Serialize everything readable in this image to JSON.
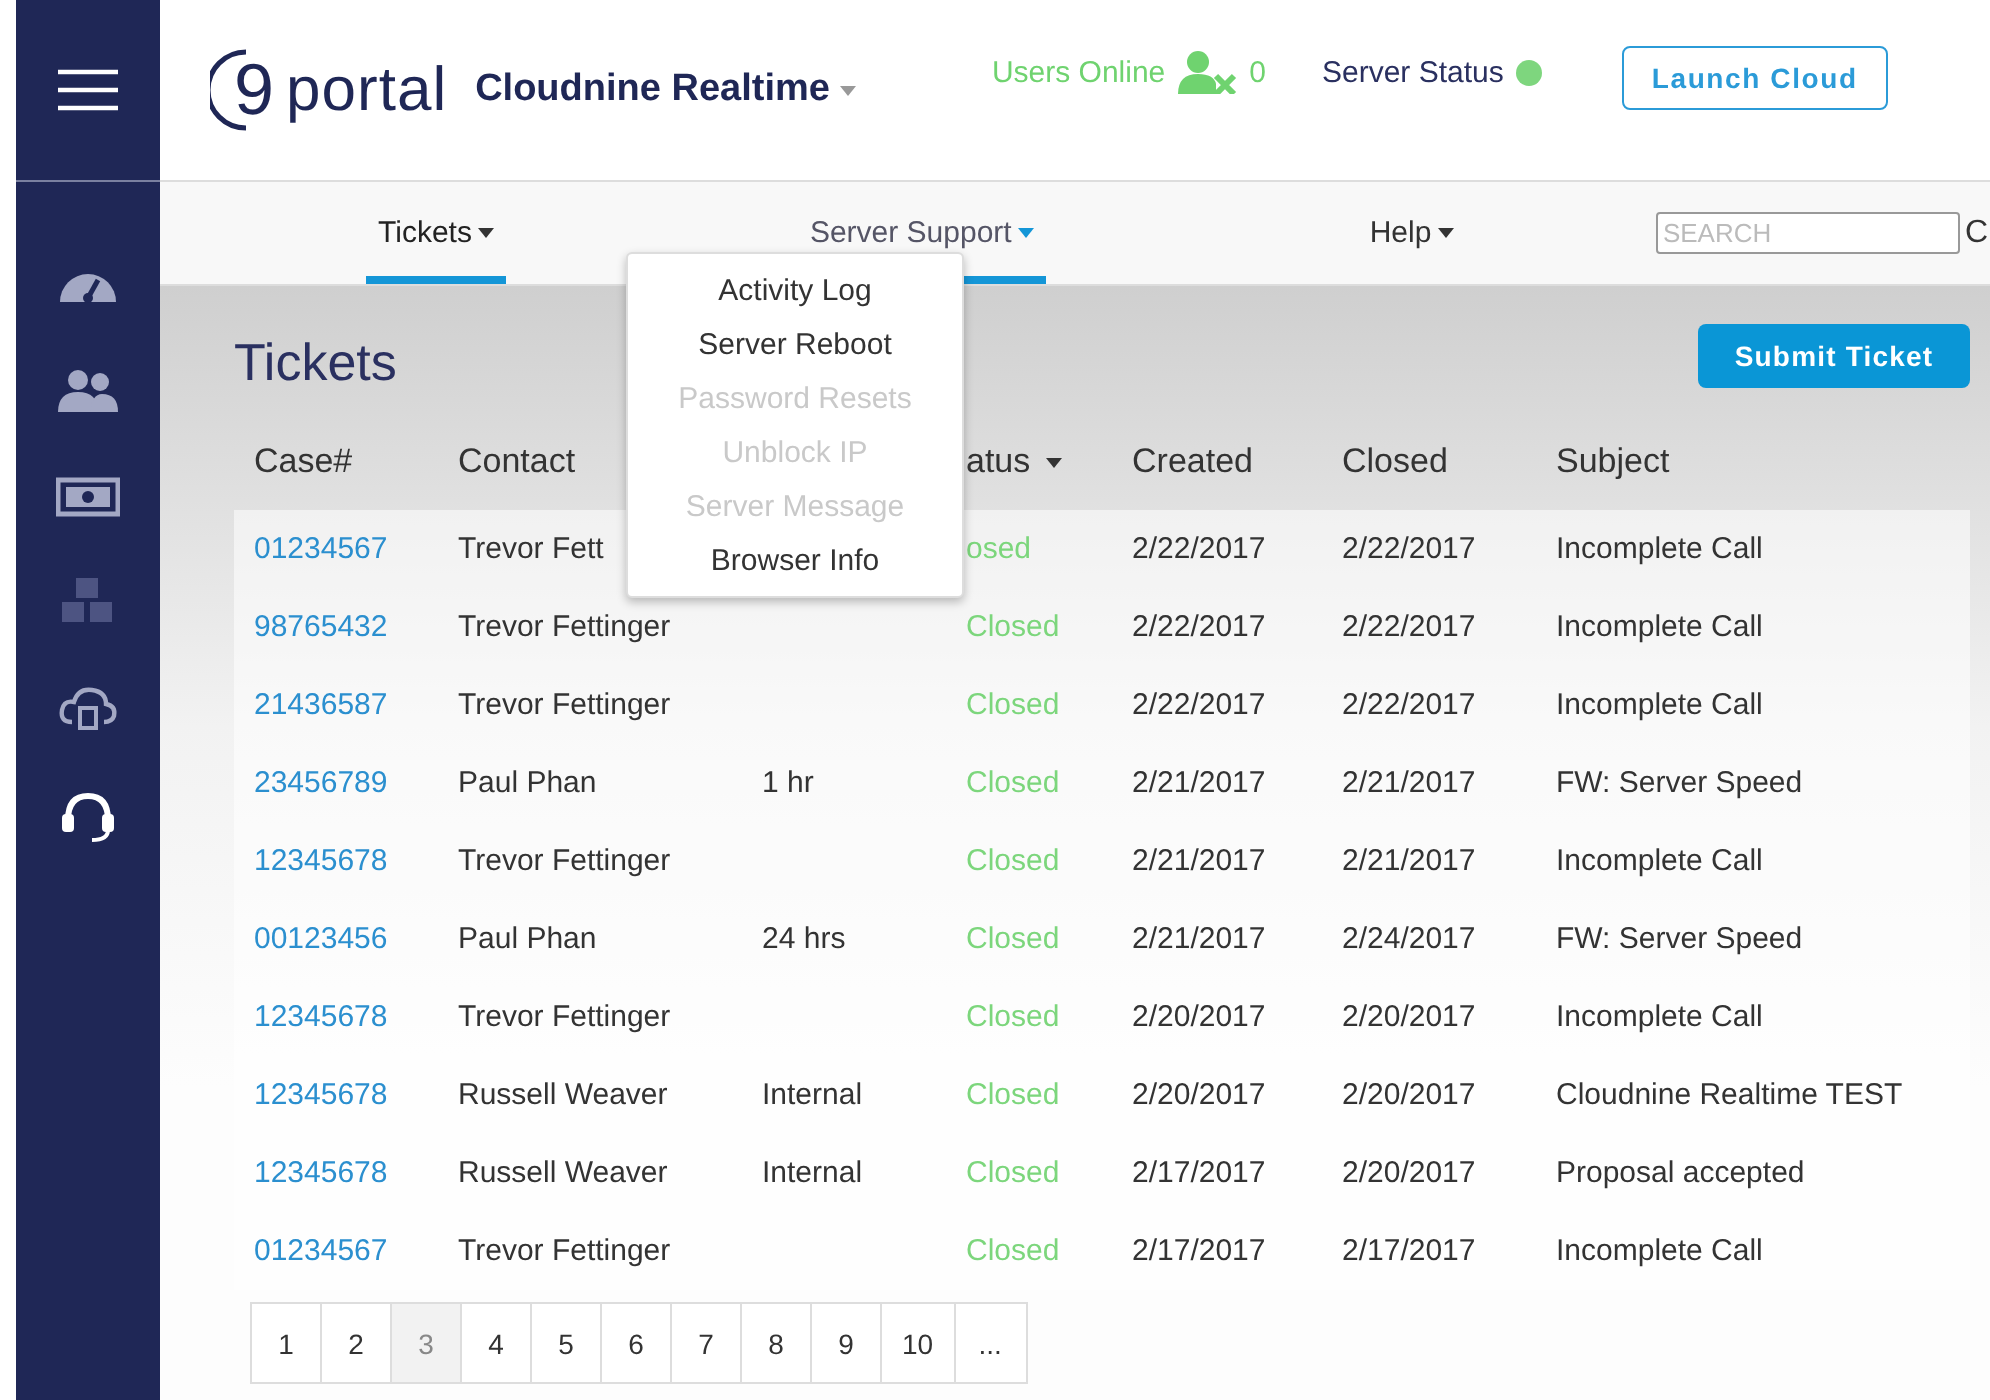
{
  "sidebar": {
    "items": [
      {
        "selected": false,
        "disabled": false
      },
      {
        "selected": false,
        "disabled": false
      },
      {
        "selected": false,
        "disabled": false
      },
      {
        "selected": false,
        "disabled": true
      },
      {
        "selected": false,
        "disabled": false
      },
      {
        "selected": true,
        "disabled": false
      }
    ]
  },
  "header": {
    "logo": {
      "mark": "9",
      "text": "portal"
    },
    "account": "Cloudnine Realtime",
    "users_online": {
      "label": "Users Online",
      "count": "0"
    },
    "server_status": {
      "label": "Server Status",
      "color": "#7ed67e"
    },
    "launch_button": "Launch Cloud"
  },
  "nav": {
    "items": [
      {
        "label": "Tickets",
        "selected": true,
        "expanded": false
      },
      {
        "label": "Server Support",
        "selected": false,
        "expanded": true
      },
      {
        "label": "Help",
        "selected": false,
        "expanded": false
      }
    ],
    "search": {
      "placeholder": "SEARCH"
    },
    "edge_text": "C"
  },
  "dropdown": {
    "items": [
      {
        "label": "Activity Log",
        "disabled": false
      },
      {
        "label": "Server Reboot",
        "disabled": false
      },
      {
        "label": "Password Resets",
        "disabled": true
      },
      {
        "label": "Unblock IP",
        "disabled": true
      },
      {
        "label": "Server Message",
        "disabled": true
      },
      {
        "label": "Browser Info",
        "disabled": false
      }
    ]
  },
  "page": {
    "title": "Tickets",
    "submit_button": "Submit Ticket"
  },
  "table": {
    "columns": [
      "Case#",
      "Contact",
      "",
      "atus",
      "Created",
      "Closed",
      "Subject"
    ],
    "rows": [
      [
        "01234567",
        "Trevor Fett",
        "",
        "osed",
        "2/22/2017",
        "2/22/2017",
        "Incomplete Call"
      ],
      [
        "98765432",
        "Trevor Fettinger",
        "",
        "Closed",
        "2/22/2017",
        "2/22/2017",
        "Incomplete Call"
      ],
      [
        "21436587",
        "Trevor Fettinger",
        "",
        "Closed",
        "2/22/2017",
        "2/22/2017",
        "Incomplete Call"
      ],
      [
        "23456789",
        "Paul Phan",
        "1 hr",
        "Closed",
        "2/21/2017",
        "2/21/2017",
        "FW: Server Speed"
      ],
      [
        "12345678",
        "Trevor Fettinger",
        "",
        "Closed",
        "2/21/2017",
        "2/21/2017",
        "Incomplete Call"
      ],
      [
        "00123456",
        "Paul Phan",
        "24 hrs",
        "Closed",
        "2/21/2017",
        "2/24/2017",
        "FW: Server Speed"
      ],
      [
        "12345678",
        "Trevor Fettinger",
        "",
        "Closed",
        "2/20/2017",
        "2/20/2017",
        "Incomplete Call"
      ],
      [
        "12345678",
        "Russell Weaver",
        "Internal",
        "Closed",
        "2/20/2017",
        "2/20/2017",
        "Cloudnine Realtime TEST"
      ],
      [
        "12345678",
        "Russell Weaver",
        "Internal",
        "Closed",
        "2/17/2017",
        "2/20/2017",
        "Proposal accepted"
      ],
      [
        "01234567",
        "Trevor Fettinger",
        "",
        "Closed",
        "2/17/2017",
        "2/17/2017",
        "Incomplete Call"
      ]
    ]
  },
  "pagination": [
    {
      "label": "1",
      "selected": false
    },
    {
      "label": "2",
      "selected": false
    },
    {
      "label": "3",
      "selected": true
    },
    {
      "label": "4",
      "selected": false
    },
    {
      "label": "5",
      "selected": false
    },
    {
      "label": "6",
      "selected": false
    },
    {
      "label": "7",
      "selected": false
    },
    {
      "label": "8",
      "selected": false
    },
    {
      "label": "9",
      "selected": false
    },
    {
      "label": "10",
      "selected": false
    },
    {
      "label": "...",
      "selected": false
    }
  ]
}
